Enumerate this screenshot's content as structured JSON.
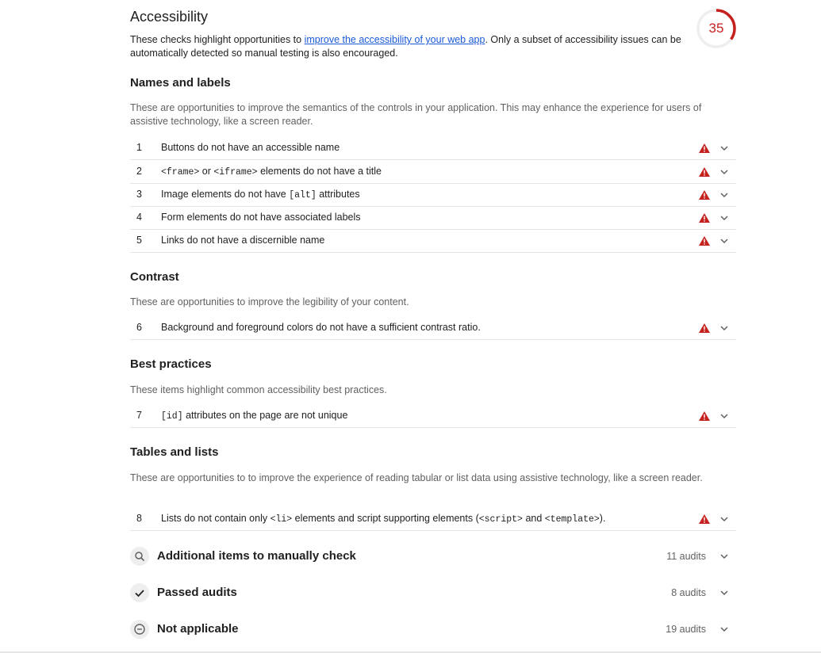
{
  "header": {
    "title": "Accessibility",
    "intro_before": "These checks highlight opportunities to ",
    "intro_link": "improve the accessibility of your web app",
    "intro_after": ". Only a subset of accessibility issues can be automatically detected so manual testing is also encouraged.",
    "score": "35",
    "score_fraction": 0.35,
    "score_color": "#c5221f"
  },
  "sections": {
    "names": {
      "title": "Names and labels",
      "desc": "These are opportunities to improve the semantics of the controls in your application. This may enhance the experience for users of assistive technology, like a screen reader."
    },
    "contrast": {
      "title": "Contrast",
      "desc": "These are opportunities to improve the legibility of your content."
    },
    "best": {
      "title": "Best practices",
      "desc": "These items highlight common accessibility best practices."
    },
    "tables": {
      "title": "Tables and lists",
      "desc": "These are opportunities to to improve the experience of reading tabular or list data using assistive technology, like a screen reader."
    }
  },
  "audits": {
    "a1": {
      "num": "1",
      "text": "Buttons do not have an accessible name"
    },
    "a2": {
      "num": "2",
      "code1": "<frame>",
      "mid": " or ",
      "code2": "<iframe>",
      "text": " elements do not have a title"
    },
    "a3": {
      "num": "3",
      "pre": "Image elements do not have ",
      "code": "[alt]",
      "post": " attributes"
    },
    "a4": {
      "num": "4",
      "text": "Form elements do not have associated labels"
    },
    "a5": {
      "num": "5",
      "text": "Links do not have a discernible name"
    },
    "a6": {
      "num": "6",
      "text": "Background and foreground colors do not have a sufficient contrast ratio."
    },
    "a7": {
      "num": "7",
      "code": "[id]",
      "text": " attributes on the page are not unique"
    },
    "a8": {
      "num": "8",
      "pre": "Lists do not contain only ",
      "code1": "<li>",
      "mid": " elements and script supporting elements (",
      "code2": "<script>",
      "and": " and ",
      "code3": "<template>",
      "post": ")."
    }
  },
  "groups": {
    "manual": {
      "label": "Additional items to manually check",
      "count": "11 audits",
      "icon": "search-icon"
    },
    "passed": {
      "label": "Passed audits",
      "count": "8 audits",
      "icon": "check-icon"
    },
    "na": {
      "label": "Not applicable",
      "count": "19 audits",
      "icon": "minus-circle-icon"
    }
  },
  "colors": {
    "fail": "#c5221f",
    "link": "#1a5ad7"
  }
}
